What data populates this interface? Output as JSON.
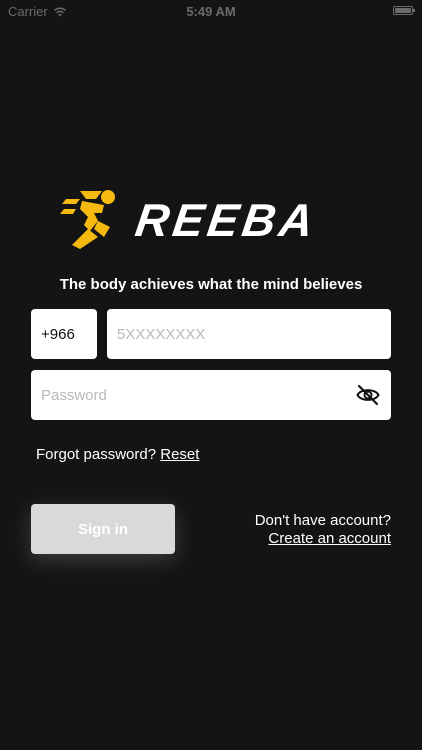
{
  "status_bar": {
    "carrier": "Carrier",
    "time": "5:49 AM"
  },
  "brand": {
    "name": "REEBA",
    "accent_color": "#F5B90F",
    "icon": "runner-icon"
  },
  "tagline": "The body achieves what the mind believes",
  "form": {
    "country_code": "+966",
    "phone_placeholder": "5XXXXXXXX",
    "password_placeholder": "Password",
    "password_toggle_icon": "eye-slash-icon"
  },
  "forgot": {
    "text": "Forgot password?",
    "reset_label": "Reset"
  },
  "sign_in_label": "Sign in",
  "signup": {
    "prompt": "Don't have account?",
    "link_label": "Create an account"
  }
}
